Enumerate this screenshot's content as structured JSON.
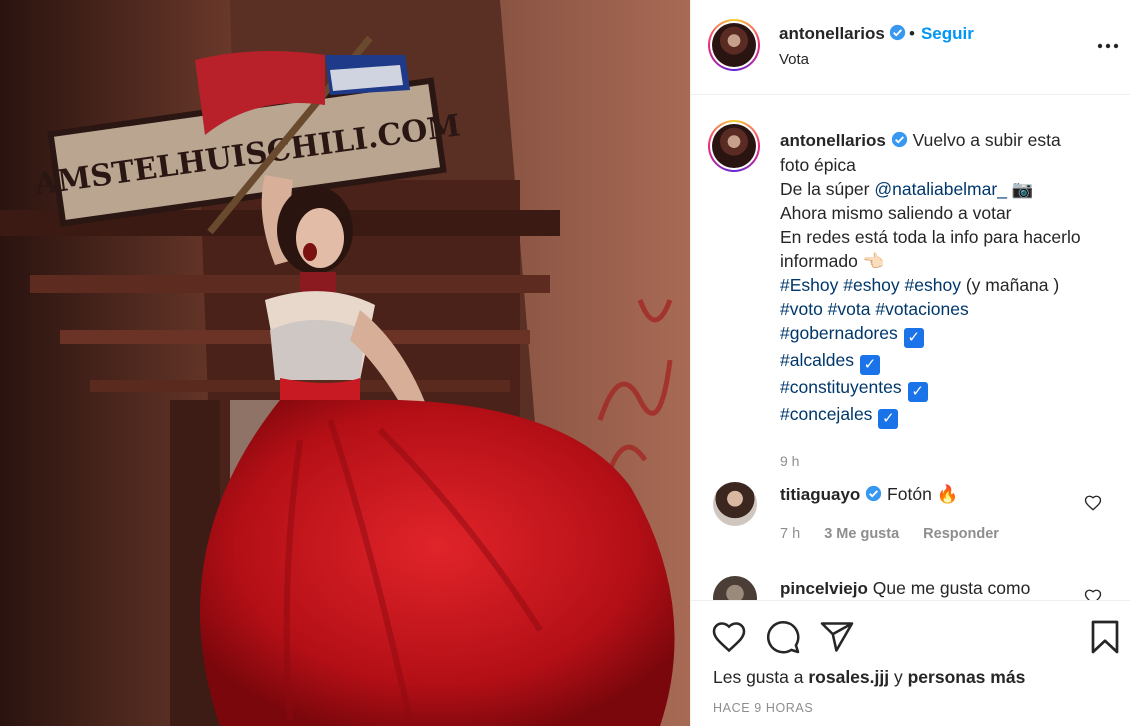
{
  "post": {
    "author": "antonellarios",
    "follow_label": "Seguir",
    "separator": "•",
    "location": "Vota"
  },
  "caption": {
    "author": "antonellarios",
    "lines": [
      "Vuelvo a subir esta",
      "foto épica",
      "De la súper",
      "@nataliabelmar_",
      "Ahora mismo saliendo a votar",
      "En redes está toda la info para hacerlo",
      "informado",
      "#Eshoy #eshoy #eshoy",
      "(y mañana )",
      "#voto #vota #votaciones",
      "#gobernadores",
      "#alcaldes",
      "#constituyentes",
      "#concejales"
    ],
    "time": "9 h"
  },
  "comments": [
    {
      "user": "titiaguayo",
      "text": "Fotón",
      "emoji": "🔥",
      "time": "7 h",
      "likes": "3 Me gusta",
      "reply": "Responder"
    },
    {
      "user": "pincelviejo",
      "text": "Que me gusta como"
    }
  ],
  "footer": {
    "likes_prefix": "Les gusta a",
    "likes_user": "rosales.jjj",
    "likes_and": "y",
    "likes_rest": "personas más",
    "time_ago": "HACE 9 HORAS"
  },
  "photo": {
    "sign_text": "AMSTELHUISCHILI.COM"
  },
  "colors": {
    "link": "#00376b",
    "follow": "#0095f6",
    "verified": "#3897f0",
    "dress": "#c8141c"
  }
}
